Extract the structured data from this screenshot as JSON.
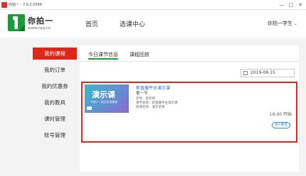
{
  "window": {
    "title": "你拍一 - 7.0.2.0586",
    "buttons": {
      "minimize": "—",
      "maximize": "□",
      "close": "✕"
    }
  },
  "header": {
    "logo_text": "你拍一",
    "logo_url": "www.npy.cn",
    "nav": [
      "首页",
      "选课中心"
    ],
    "user_label": "你拍一学生",
    "user_chevron": "⌄"
  },
  "sidebar": {
    "items": [
      {
        "label": "我的课程"
      },
      {
        "label": "我的订单"
      },
      {
        "label": "我的优惠券"
      },
      {
        "label": "我的教具"
      },
      {
        "label": "课时管理"
      },
      {
        "label": "账号管理"
      }
    ]
  },
  "tabs": [
    {
      "label": "今日课节信息"
    },
    {
      "label": "课程回放"
    }
  ],
  "date_value": "2019-08-15",
  "course": {
    "thumb_title": "演示课",
    "thumb_sub": "你拍一 高品质直播课",
    "title": "新直播平台演示课",
    "subtitle": "第一节",
    "info": [
      "老师：李老师",
      "课节名称：新直播平台演示课",
      "授课老师：演示老师"
    ],
    "time": "16:00 开始",
    "enter_button": "进入教室"
  },
  "colors": {
    "accent_red": "#e1251b",
    "brand_green": "#1a9b3a",
    "link_blue": "#1f73c9"
  }
}
